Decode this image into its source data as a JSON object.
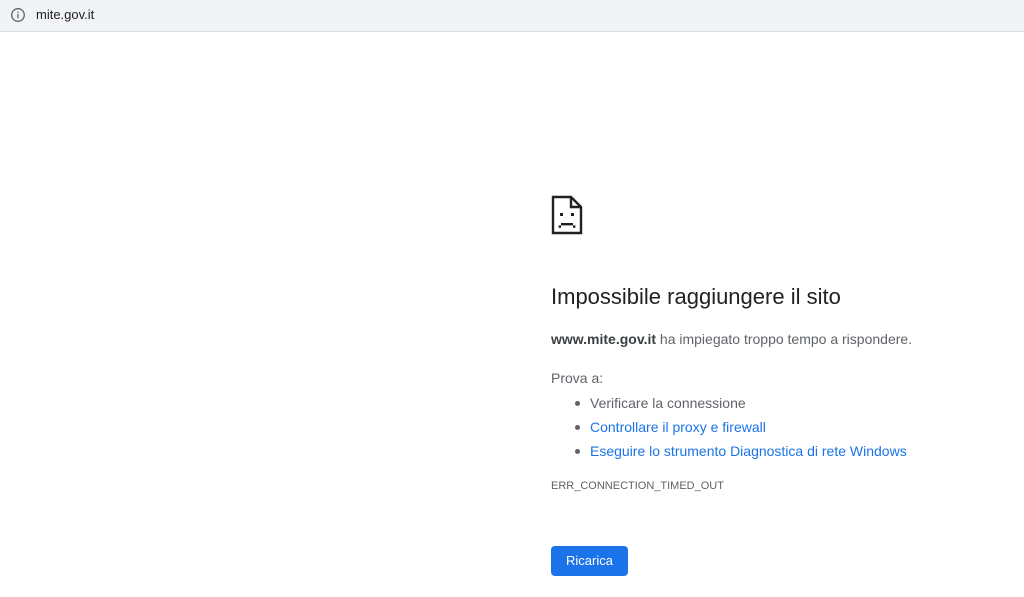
{
  "address_bar": {
    "url": "mite.gov.it",
    "icon": "info-icon"
  },
  "error": {
    "icon": "sad-page-icon",
    "title": "Impossibile raggiungere il sito",
    "host": "www.mite.gov.it",
    "description_rest": " ha impiegato troppo tempo a rispondere.",
    "try_label": "Prova a:",
    "suggestions": [
      {
        "label": "Verificare la connessione",
        "link": false
      },
      {
        "label": "Controllare il proxy e firewall",
        "link": true
      },
      {
        "label": "Eseguire lo strumento Diagnostica di rete Windows",
        "link": true
      }
    ],
    "code": "ERR_CONNECTION_TIMED_OUT",
    "reload_label": "Ricarica"
  },
  "colors": {
    "accent": "#1a73e8",
    "text": "#202124",
    "secondary_text": "#5f6368",
    "toolbar_bg": "#f1f3f4"
  }
}
